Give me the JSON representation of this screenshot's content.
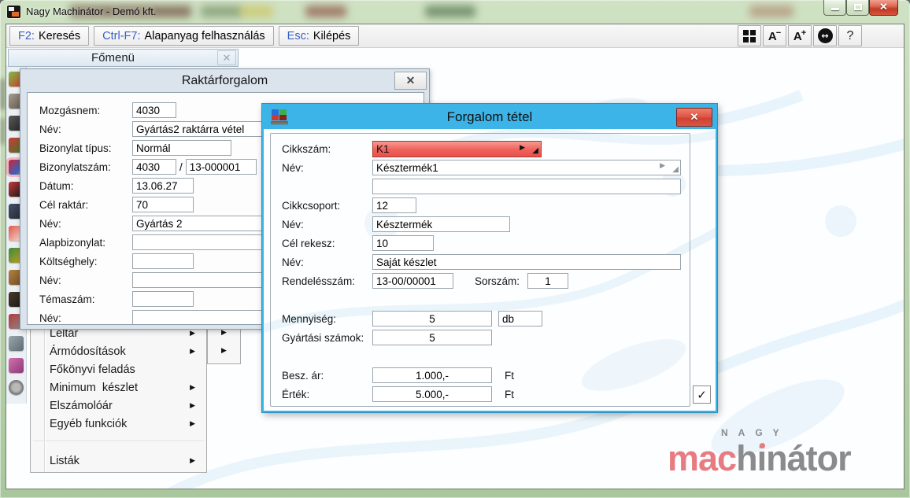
{
  "app": {
    "title": "Nagy Machinátor - Demó kft.",
    "window_controls": [
      "minimize",
      "maximize",
      "close"
    ]
  },
  "colors": {
    "titlebar_green": "#b9d0ae",
    "dialog_blue": "#3db4e8",
    "alert_field_red": "#ee625b",
    "close_button_red": "#d84b3a",
    "shortcut_blue": "#3a5fc8",
    "logo_pink": "#e87b80",
    "logo_gray": "#8b8b8d"
  },
  "toolbar": {
    "buttons": [
      {
        "key": "F2:",
        "label": "Keresés"
      },
      {
        "key": "Ctrl-F7:",
        "label": "Alapanyag felhasználás"
      },
      {
        "key": "Esc:",
        "label": "Kilépés"
      }
    ]
  },
  "fomenu": {
    "label": "Főmenü"
  },
  "raktarforgalom": {
    "title": "Raktárforgalom",
    "rows": [
      {
        "label": "Mozgásnem:",
        "value": "4030"
      },
      {
        "label": "Név:",
        "value": "Gyártás2 raktárra vétel"
      },
      {
        "label": "Bizonylat típus:",
        "value": "Normál"
      },
      {
        "label": "Bizonylatszám:",
        "value": "4030",
        "sep": "/",
        "value2": "13-000001"
      },
      {
        "label": "Dátum:",
        "value": "13.06.27"
      },
      {
        "label": "Cél raktár:",
        "value": "70"
      },
      {
        "label": "Név:",
        "value": "Gyártás 2"
      },
      {
        "label": "Alapbizonylat:",
        "value": ""
      },
      {
        "label": "Költséghely:",
        "value": ""
      },
      {
        "label": "Név:",
        "value": ""
      },
      {
        "label": "Témaszám:",
        "value": ""
      },
      {
        "label": "Név:",
        "value": ""
      }
    ]
  },
  "menu": {
    "items": [
      {
        "label": "Leltár"
      },
      {
        "label": "Ármódosítások"
      },
      {
        "label": "Főkönyvi feladás"
      },
      {
        "label": "Minimum  készlet"
      },
      {
        "label": "Elszámolóár"
      },
      {
        "label": "Egyéb funkciók"
      },
      {
        "label": "Listák"
      }
    ]
  },
  "forgalom_tetel": {
    "title": "Forgalom tétel",
    "rows": [
      {
        "label": "Cikkszám:",
        "value": "K1"
      },
      {
        "label": "Név:",
        "value": "Késztermék1"
      },
      {
        "label": "",
        "value": ""
      },
      {
        "label": "Cikkcsoport:",
        "value": "12"
      },
      {
        "label": "Név:",
        "value": "Késztermék"
      },
      {
        "label": "Cél rekesz:",
        "value": "10"
      },
      {
        "label": "Név:",
        "value": "Saját készlet"
      },
      {
        "label": "Rendelésszám:",
        "value": "13-00/00001",
        "label2": "Sorszám:",
        "value2": "1"
      },
      {
        "label": "Mennyiség:",
        "value": "5",
        "unit": "db"
      },
      {
        "label": "Gyártási számok:",
        "value": "5"
      },
      {
        "label": "Besz. ár:",
        "value": "1.000,-",
        "unit": "Ft"
      },
      {
        "label": "Érték:",
        "value": "5.000,-",
        "unit": "Ft"
      }
    ]
  },
  "logo": {
    "top": "NAGY",
    "part_pink": "mac",
    "part_h": "h",
    "part_i": "i",
    "part_rest": "nátor"
  }
}
